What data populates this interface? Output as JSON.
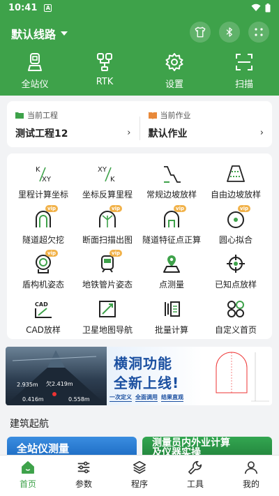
{
  "status": {
    "time": "10:41",
    "badge": "A"
  },
  "header": {
    "route": "默认线路",
    "nav": [
      "全站仪",
      "RTK",
      "设置",
      "扫描"
    ]
  },
  "project": {
    "current_project_label": "当前工程",
    "current_project": "测试工程12",
    "current_job_label": "当前作业",
    "current_job": "默认作业"
  },
  "functions": [
    {
      "label": "里程计算坐标",
      "vip": ""
    },
    {
      "label": "坐标反算里程",
      "vip": ""
    },
    {
      "label": "常规边坡放样",
      "vip": ""
    },
    {
      "label": "自由边坡放样",
      "vip": ""
    },
    {
      "label": "隧道超欠挖",
      "vip": "vip"
    },
    {
      "label": "断面扫描出图",
      "vip": "vip"
    },
    {
      "label": "隧道特征点正算",
      "vip": "vip"
    },
    {
      "label": "圆心拟合",
      "vip": "vip"
    },
    {
      "label": "盾构机姿态",
      "vip": "vip"
    },
    {
      "label": "地铁管片姿态",
      "vip": "vip"
    },
    {
      "label": "点测量",
      "vip": ""
    },
    {
      "label": "已知点放样",
      "vip": ""
    },
    {
      "label": "CAD放样",
      "vip": ""
    },
    {
      "label": "卫星地图导航",
      "vip": ""
    },
    {
      "label": "批量计算",
      "vip": ""
    },
    {
      "label": "自定义首页",
      "vip": ""
    }
  ],
  "icon_text": {
    "k_xy_top": "K",
    "k_xy_bottom": "XY",
    "xy_k_top": "XY",
    "xy_k_bottom": "K",
    "cad": "CAD"
  },
  "banner": {
    "title_line1": "横洞功能",
    "title_line2": "全新上线!",
    "tags": [
      "一次定义",
      "全面调用",
      "结果直观"
    ],
    "readouts": [
      "2.935m",
      "欠2.419m",
      "0.416m",
      "0.558m"
    ]
  },
  "section": {
    "title": "建筑起航",
    "promo1": "全站仪测量",
    "promo2_line1": "测量员内外业计算",
    "promo2_line2": "及仪器实操"
  },
  "bottom_nav": [
    "首页",
    "参数",
    "程序",
    "工具",
    "我的"
  ],
  "colors": {
    "primary": "#3ea24a",
    "vip": "#f1b24a",
    "banner_blue": "#1a4fa0"
  }
}
